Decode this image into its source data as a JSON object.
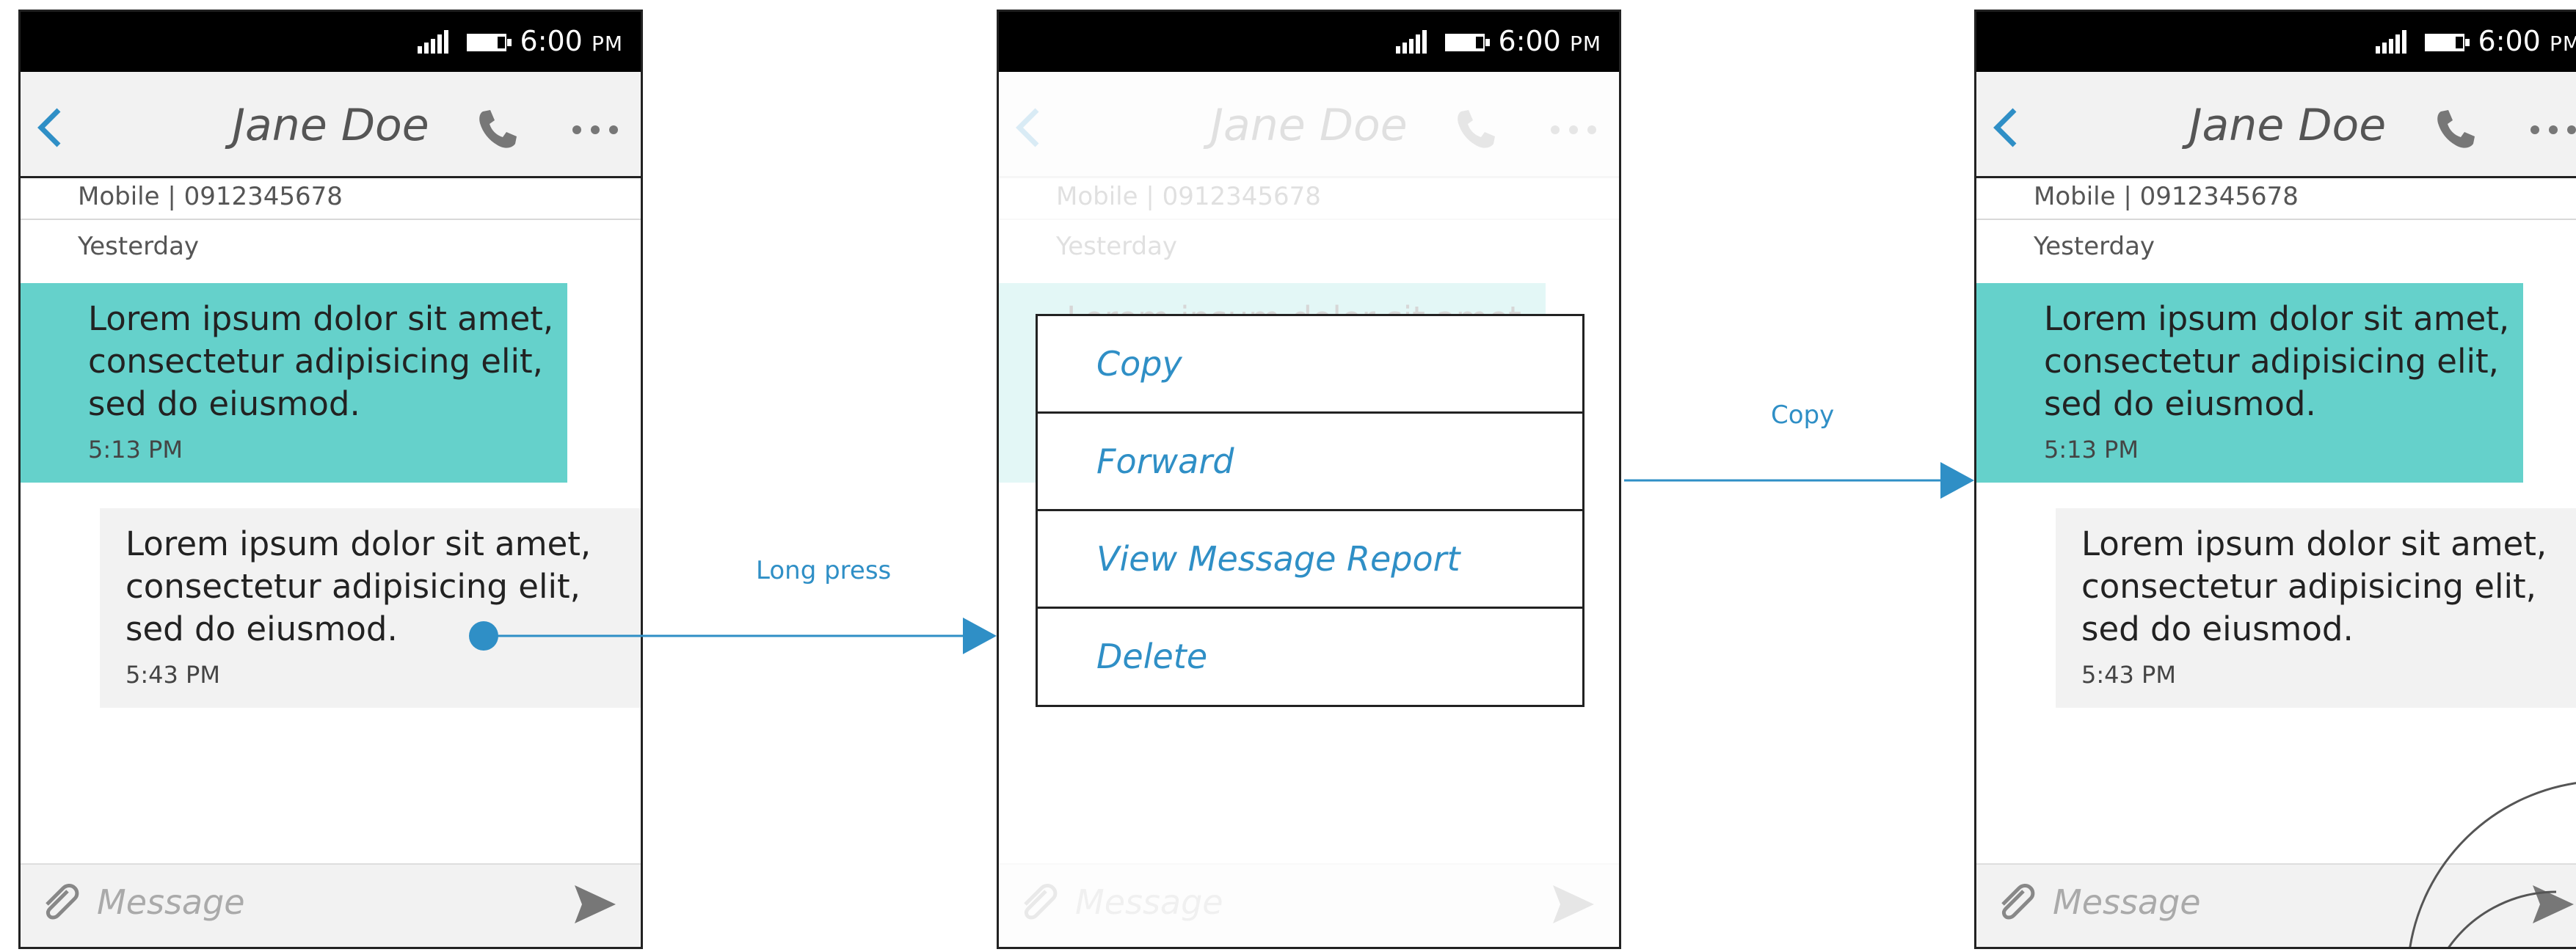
{
  "status_bar": {
    "time": "6:00",
    "ampm": "PM"
  },
  "conversation": {
    "contact_name": "Jane Doe",
    "contact_line": "Mobile | 0912345678",
    "date_label": "Yesterday",
    "messages": [
      {
        "text": "Lorem ipsum dolor sit amet, consectetur adipisicing elit, sed do eiusmod.",
        "time": "5:13 PM"
      },
      {
        "text": "Lorem ipsum dolor sit amet, consectetur adipisicing elit, sed do eiusmod.",
        "time": "5:43 PM"
      }
    ],
    "compose_placeholder": "Message"
  },
  "context_menu": {
    "items": [
      "Copy",
      "Forward",
      "View Message Report",
      "Delete"
    ]
  },
  "transitions": {
    "long_press": "Long press",
    "copy": "Copy"
  },
  "colors": {
    "accent": "#2f8fc6",
    "incoming_bubble": "#65d1cb",
    "outgoing_bubble": "#f2f2f2"
  }
}
